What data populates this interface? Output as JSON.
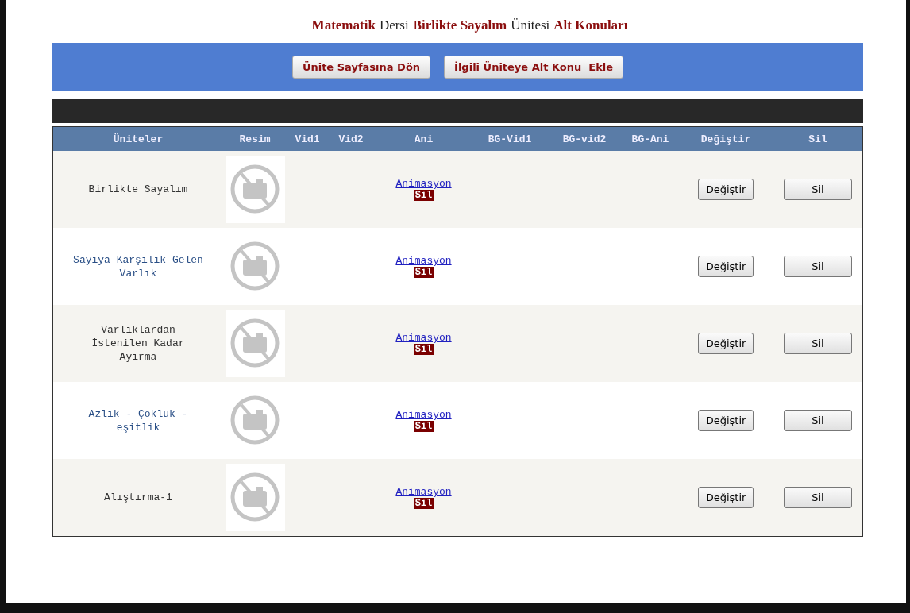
{
  "heading": {
    "parts": [
      {
        "text": "Matematik",
        "strong": true
      },
      {
        "text": "Dersi",
        "strong": false
      },
      {
        "text": "Birlikte Sayalım",
        "strong": true
      },
      {
        "text": "Ünitesi",
        "strong": false
      },
      {
        "text": "Alt Konuları",
        "strong": true
      }
    ]
  },
  "toolbar": {
    "buttons": [
      "Ünite Sayfasına Dön",
      "İlgili Üniteye Alt Konu  Ekle"
    ]
  },
  "table": {
    "columns": [
      "Üniteler",
      "Resim",
      "Vid1",
      "Vid2",
      "Ani",
      "BG-Vid1",
      "BG-vid2",
      "BG-Ani",
      "Değiştir",
      "Sil"
    ],
    "rows": [
      {
        "name": "Birlikte Sayalım",
        "image": {
          "kind": "placeholder"
        },
        "ani_link": "Animasyon",
        "ani_delete": "Sil",
        "edit": "Değiştir",
        "delete": "Sil"
      },
      {
        "name": "Sayıya Karşılık Gelen Varlık",
        "image": {
          "kind": "placeholder"
        },
        "ani_link": "Animasyon",
        "ani_delete": "Sil",
        "edit": "Değiştir",
        "delete": "Sil"
      },
      {
        "name": "Varlıklardan İstenilen Kadar Ayırma",
        "image": {
          "kind": "placeholder"
        },
        "ani_link": "Animasyon",
        "ani_delete": "Sil",
        "edit": "Değiştir",
        "delete": "Sil"
      },
      {
        "name": "Azlık - Çokluk - eşitlik",
        "image": {
          "kind": "placeholder"
        },
        "ani_link": "Animasyon",
        "ani_delete": "Sil",
        "edit": "Değiştir",
        "delete": "Sil"
      },
      {
        "name": "Alıştırma-1",
        "image": {
          "kind": "placeholder"
        },
        "ani_link": "Animasyon",
        "ani_delete": "Sil",
        "edit": "Değiştir",
        "delete": "Sil"
      }
    ]
  }
}
